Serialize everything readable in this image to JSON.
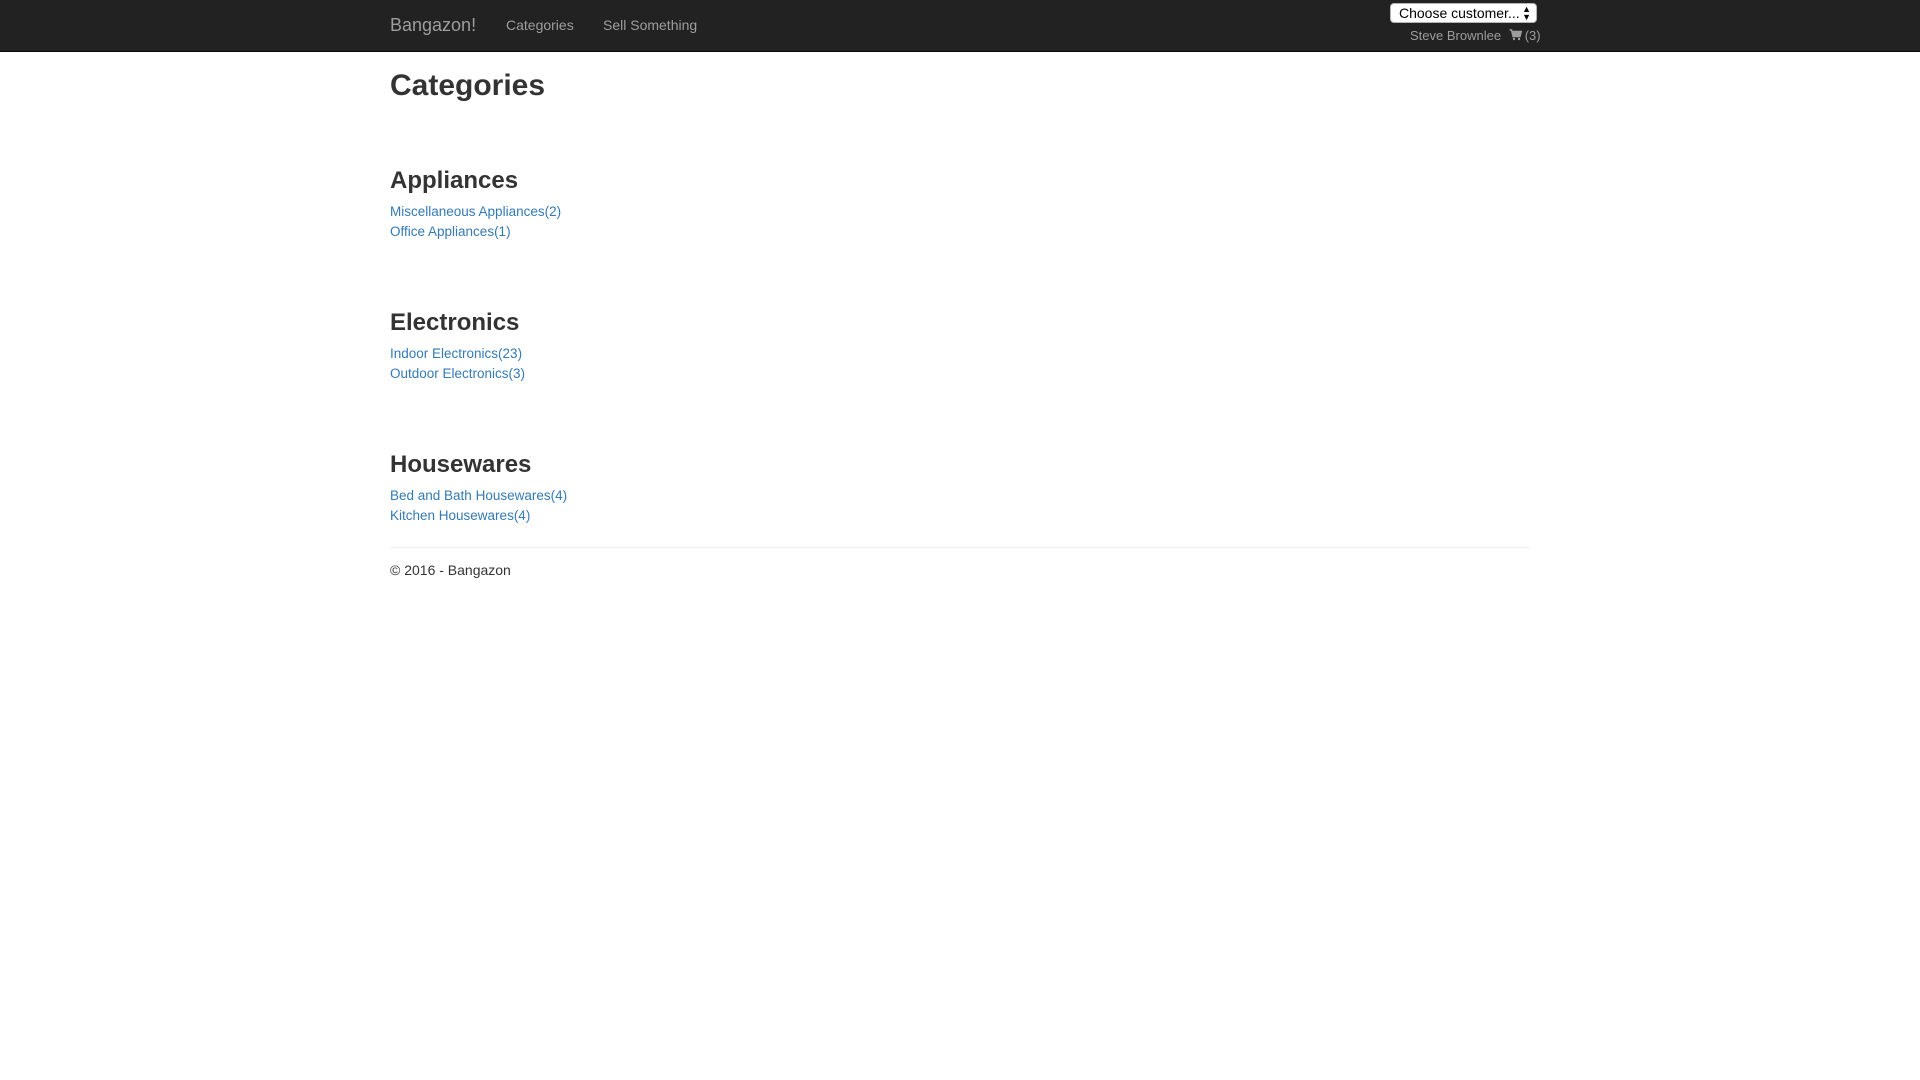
{
  "navbar": {
    "brand": "Bangazon!",
    "links": [
      {
        "label": "Categories"
      },
      {
        "label": "Sell Something"
      }
    ],
    "customer_select": {
      "selected": "Choose customer..."
    },
    "user": {
      "name": "Steve Brownlee",
      "cart_count": "(3)",
      "cart_icon": "shopping-cart-icon"
    }
  },
  "page": {
    "title": "Categories"
  },
  "categories": [
    {
      "name": "Appliances",
      "subcategories": [
        {
          "label": "Miscellaneous Appliances(2)"
        },
        {
          "label": "Office Appliances(1)"
        }
      ]
    },
    {
      "name": "Electronics",
      "subcategories": [
        {
          "label": "Indoor Electronics(23)"
        },
        {
          "label": "Outdoor Electronics(3)"
        }
      ]
    },
    {
      "name": "Housewares",
      "subcategories": [
        {
          "label": "Bed and Bath Housewares(4)"
        },
        {
          "label": "Kitchen Housewares(4)"
        }
      ]
    }
  ],
  "footer": {
    "text": "© 2016 - Bangazon"
  },
  "colors": {
    "navbar_bg": "#222222",
    "nav_text": "#9d9d9d",
    "link": "#337ab7",
    "heading": "#333333"
  }
}
